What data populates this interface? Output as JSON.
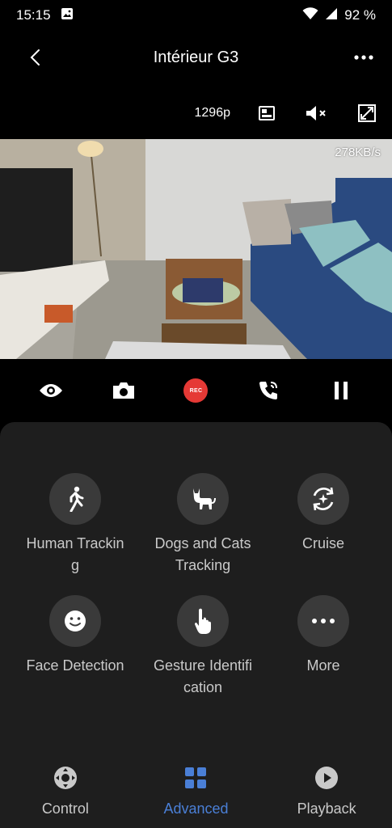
{
  "status_bar": {
    "time": "15:15",
    "battery": "92 %"
  },
  "header": {
    "title": "Intérieur G3"
  },
  "video": {
    "resolution": "1296p",
    "bitrate": "278KB/s"
  },
  "live_controls": {
    "rec_label": "REC"
  },
  "features": [
    {
      "label": "Human Tracking",
      "icon": "walking-person-icon"
    },
    {
      "label": "Dogs and Cats Tracking",
      "icon": "cat-icon"
    },
    {
      "label": "Cruise",
      "icon": "rotate-icon"
    },
    {
      "label": "Face Detection",
      "icon": "smiley-face-icon"
    },
    {
      "label": "Gesture Identification",
      "icon": "pointing-hand-icon"
    },
    {
      "label": "More",
      "icon": "more-dots-icon"
    }
  ],
  "nav": {
    "items": [
      {
        "label": "Control",
        "icon": "dpad-icon"
      },
      {
        "label": "Advanced",
        "icon": "grid-icon"
      },
      {
        "label": "Playback",
        "icon": "play-icon"
      }
    ],
    "active": "Advanced",
    "accent": "#4a7fd6"
  }
}
